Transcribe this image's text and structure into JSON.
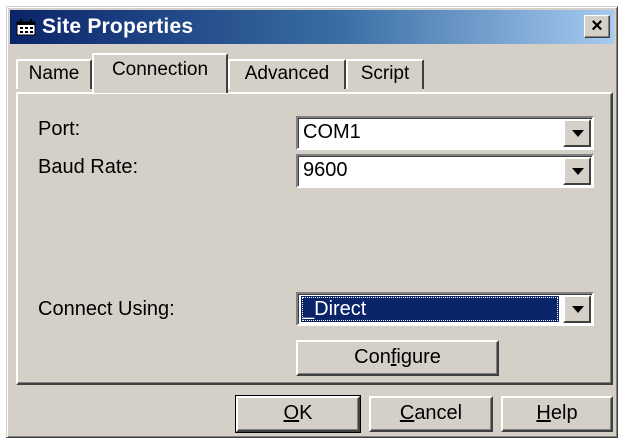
{
  "window": {
    "title": "Site Properties",
    "close_glyph": "×"
  },
  "tabs": [
    {
      "label": "Name",
      "active": false
    },
    {
      "label": "Connection",
      "active": true
    },
    {
      "label": "Advanced",
      "active": false
    },
    {
      "label": "Script",
      "active": false
    }
  ],
  "connection": {
    "port": {
      "label": "Port:",
      "value": "COM1"
    },
    "baud_rate": {
      "label": "Baud Rate:",
      "value": "9600"
    },
    "connect_using": {
      "label": "Connect Using:",
      "value": "_Direct"
    },
    "configure_button": {
      "pre": "Con",
      "accel": "f",
      "post": "igure"
    }
  },
  "buttons": {
    "ok": {
      "accel": "O",
      "rest": "K"
    },
    "cancel": {
      "accel": "C",
      "rest": "ancel"
    },
    "help": {
      "accel": "H",
      "rest": "elp"
    }
  },
  "icons": {
    "app": "site-properties-icon",
    "close": "close-icon",
    "dropdown": "chevron-down-icon"
  },
  "colors": {
    "titlebar_start": "#0a246a",
    "titlebar_end": "#a6caf0",
    "face": "#d4d0c8",
    "selection": "#0a246a"
  }
}
